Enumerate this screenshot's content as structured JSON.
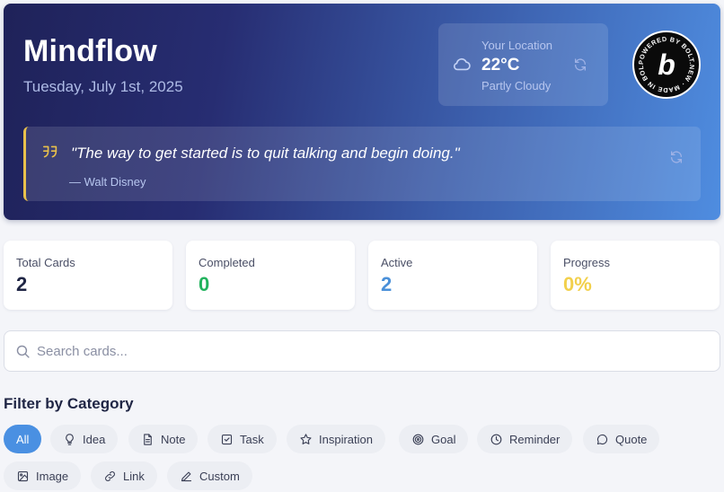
{
  "header": {
    "title": "Mindflow",
    "date": "Tuesday, July 1st, 2025"
  },
  "weather": {
    "location": "Your Location",
    "temperature": "22°C",
    "condition": "Partly Cloudy",
    "icon": "cloud-icon"
  },
  "badge": {
    "text": "POWERED BY BOLT.NEW · MADE IN BOLT.NEW ·",
    "letter": "b"
  },
  "quote": {
    "text": "\"The way to get started is to quit talking and begin doing.\"",
    "author": "— Walt Disney",
    "accent_color": "#e9c14b"
  },
  "stats": [
    {
      "label": "Total Cards",
      "value": "2",
      "color": "#1f2544"
    },
    {
      "label": "Completed",
      "value": "0",
      "color": "#22b35e"
    },
    {
      "label": "Active",
      "value": "2",
      "color": "#4a90d9"
    },
    {
      "label": "Progress",
      "value": "0%",
      "color": "#f2d04c"
    }
  ],
  "search": {
    "placeholder": "Search cards...",
    "value": ""
  },
  "filters": {
    "heading": "Filter by Category",
    "active_color": "#4a90e2",
    "chips": [
      {
        "label": "All",
        "icon": "",
        "active": true
      },
      {
        "label": "Idea",
        "icon": "lightbulb-icon"
      },
      {
        "label": "Note",
        "icon": "document-icon"
      },
      {
        "label": "Task",
        "icon": "checkbox-icon"
      },
      {
        "label": "Inspiration",
        "icon": "star-icon"
      },
      {
        "label": "Goal",
        "icon": "target-icon"
      },
      {
        "label": "Reminder",
        "icon": "clock-icon"
      },
      {
        "label": "Quote",
        "icon": "speech-bubble-icon"
      },
      {
        "label": "Image",
        "icon": "image-icon"
      },
      {
        "label": "Link",
        "icon": "link-icon"
      },
      {
        "label": "Custom",
        "icon": "pencil-icon"
      }
    ]
  }
}
